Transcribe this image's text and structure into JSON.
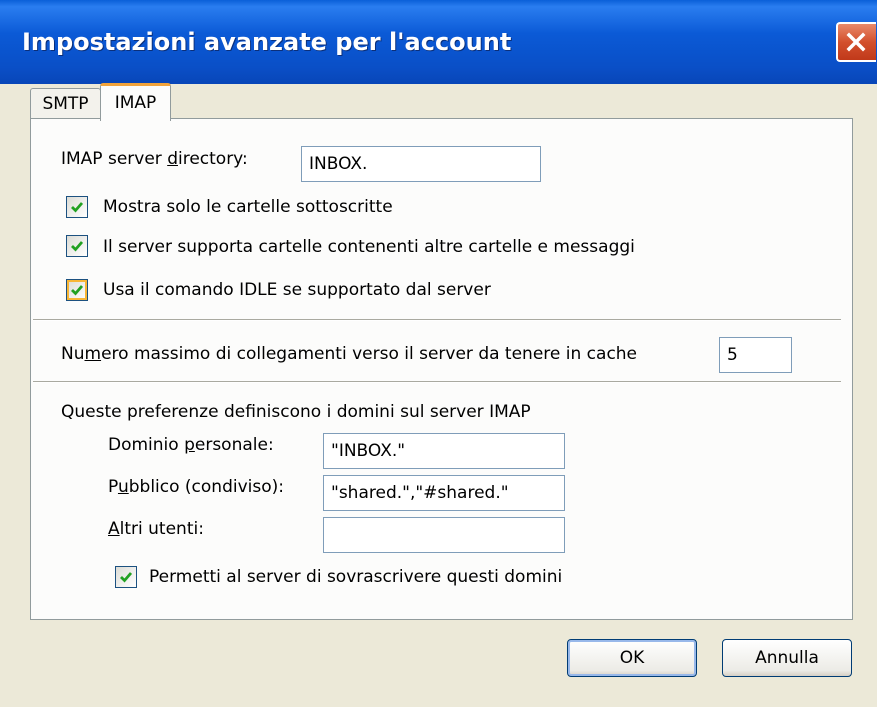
{
  "window": {
    "title": "Impostazioni avanzate per l'account",
    "close_icon": "close-icon"
  },
  "tabs": [
    {
      "label": "SMTP",
      "selected": false
    },
    {
      "label": "IMAP",
      "selected": true
    }
  ],
  "imap": {
    "server_directory_label_pre": "IMAP server ",
    "server_directory_label_ul": "d",
    "server_directory_label_post": "irectory:",
    "server_directory_value": "INBOX.",
    "checkboxes": [
      {
        "label": "Mostra solo le cartelle sottoscritte",
        "checked": true
      },
      {
        "label": "Il server supporta cartelle contenenti altre cartelle e messaggi",
        "checked": true
      },
      {
        "label": "Usa il comando IDLE se supportato dal server",
        "checked": true
      }
    ],
    "max_connections_label_pre": "Nu",
    "max_connections_label_ul": "m",
    "max_connections_label_post": "ero massimo di collegamenti  verso il server da tenere in cache",
    "max_connections_value": "5",
    "namespaces_heading": "Queste preferenze definiscono i domini sul server IMAP",
    "personal_label_pre": "Dominio ",
    "personal_label_ul": "p",
    "personal_label_post": "ersonale:",
    "personal_value": "\"INBOX.\"",
    "public_label_pre": "P",
    "public_label_ul": "u",
    "public_label_post": "bblico (condiviso):",
    "public_value": "\"shared.\",\"#shared.\"",
    "other_label_pre": "",
    "other_label_ul": "A",
    "other_label_post": "ltri utenti:",
    "other_value": "",
    "override_label": "Permetti al server di sovrascrivere questi domini",
    "override_checked": true
  },
  "buttons": {
    "ok": "OK",
    "cancel": "Annulla"
  },
  "colors": {
    "titlebar": "#0a5fd8",
    "close": "#d3502d",
    "tab_highlight": "#f1a33b",
    "checkmark": "#21a121"
  }
}
